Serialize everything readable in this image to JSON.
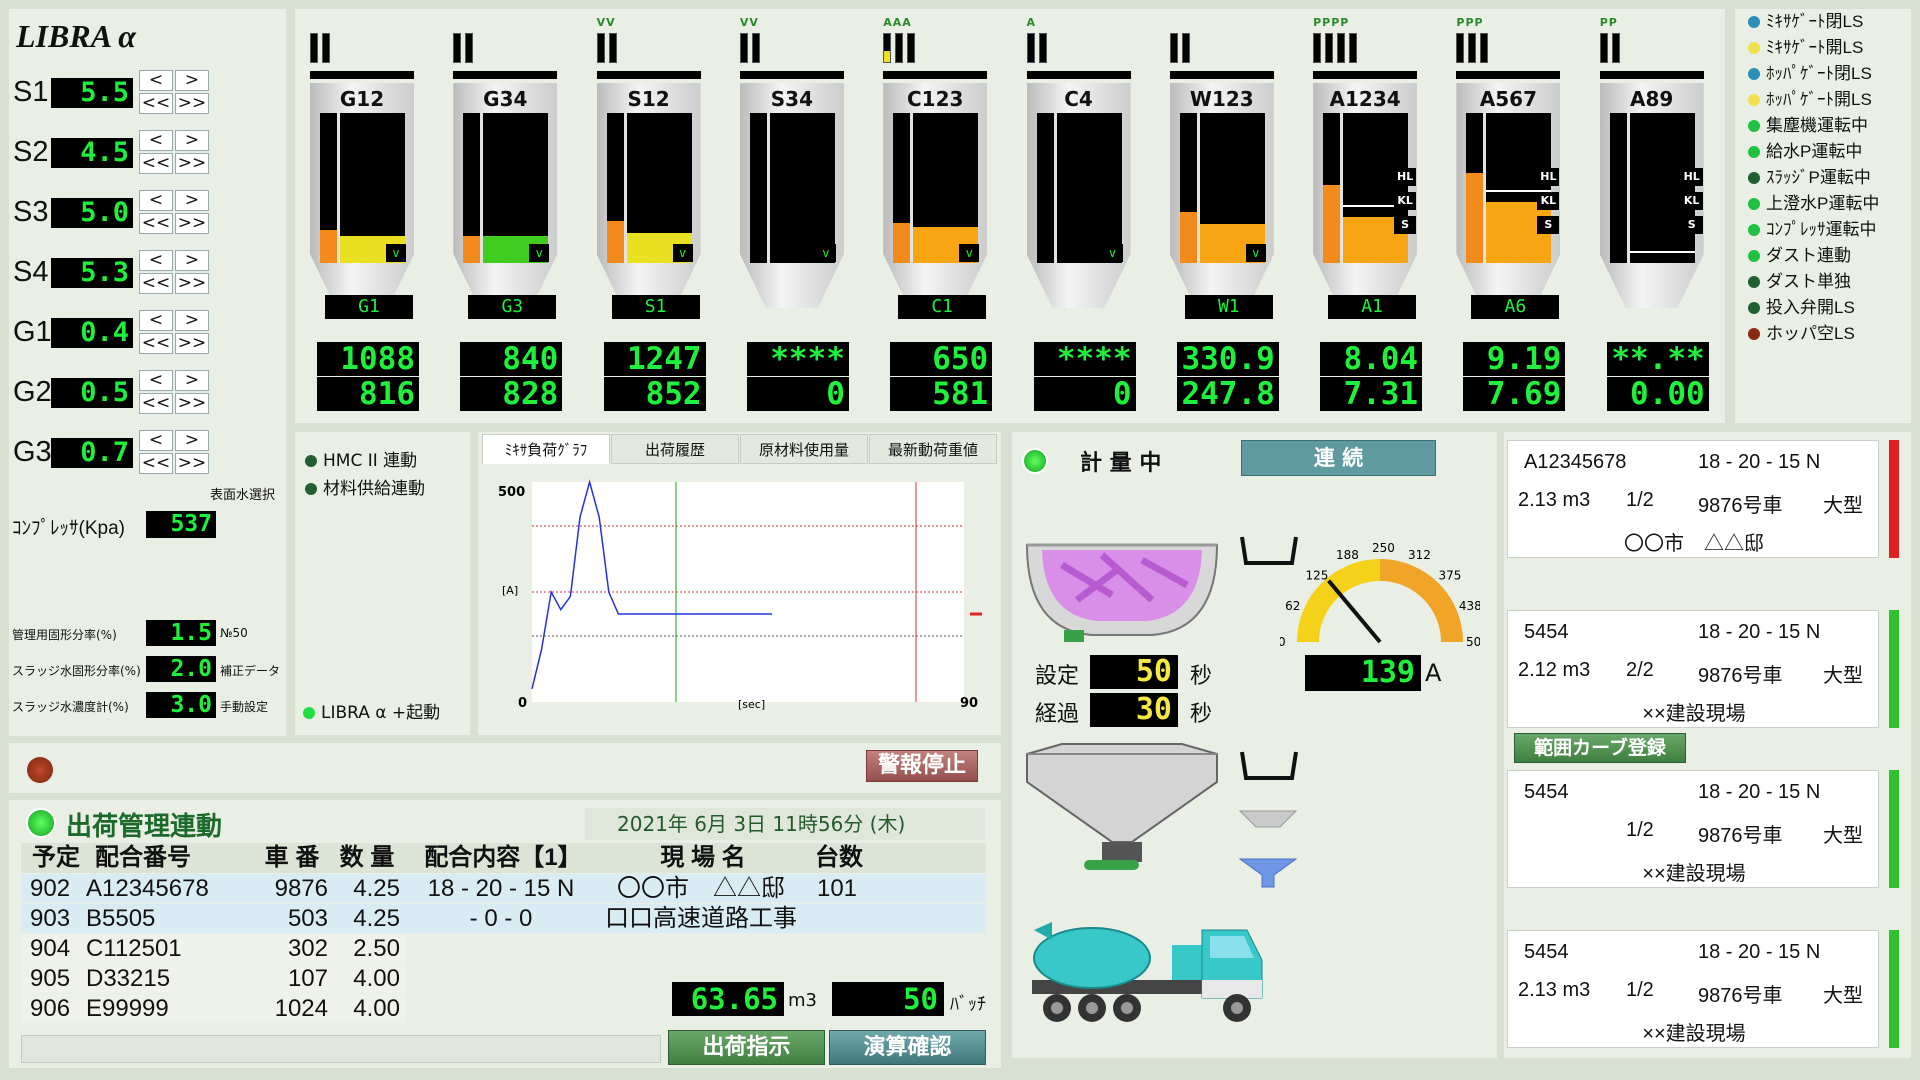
{
  "logo": "LIBRA α",
  "setpoints": [
    {
      "label": "S1",
      "value": "5.5"
    },
    {
      "label": "S2",
      "value": "4.5"
    },
    {
      "label": "S3",
      "value": "5.0"
    },
    {
      "label": "S4",
      "value": "5.3"
    },
    {
      "label": "G1",
      "value": "0.4"
    },
    {
      "label": "G2",
      "value": "0.5"
    },
    {
      "label": "G3",
      "value": "0.7"
    }
  ],
  "step_buttons": {
    "up": "<",
    "down": ">",
    "fast_up": "<<",
    "fast_down": ">>"
  },
  "surface_water_select": "表面水選択",
  "compressor": {
    "label": "ｺﾝﾌﾟﾚｯｻ(Kpa)",
    "value": "537"
  },
  "ratios": [
    {
      "label": "管理用固形分率(%)",
      "value": "1.5",
      "note": "№50"
    },
    {
      "label": "スラッジ水固形分率(%)",
      "value": "2.0",
      "note": "補正データ"
    },
    {
      "label": "スラッジ水濃度計(%)",
      "value": "3.0",
      "note": "手動設定"
    }
  ],
  "silos": [
    {
      "name": "G12",
      "mat": "G1",
      "top": "1088",
      "bottom": "816",
      "pips": "",
      "lvl": 0.22,
      "fill": 0.18,
      "color": "#e8e020",
      "tags": "v"
    },
    {
      "name": "G34",
      "mat": "G3",
      "top": "840",
      "bottom": "828",
      "pips": "",
      "lvl": 0.18,
      "fill": 0.18,
      "color": "#40cc20",
      "tags": "v"
    },
    {
      "name": "S12",
      "mat": "S1",
      "top": "1247",
      "bottom": "852",
      "pips": "VV",
      "lvl": 0.28,
      "fill": 0.2,
      "color": "#e8e020",
      "tags": "v"
    },
    {
      "name": "S34",
      "mat": "",
      "top": "****",
      "bottom": "0",
      "pips": "VV",
      "lvl": 0,
      "fill": 0,
      "color": "#e8e020",
      "tags": "v"
    },
    {
      "name": "C123",
      "mat": "C1",
      "top": "650",
      "bottom": "581",
      "pips": "AAA",
      "lvl": 0.27,
      "fill": 0.24,
      "color": "#f7a513",
      "tags": "v"
    },
    {
      "name": "C4",
      "mat": "",
      "top": "****",
      "bottom": "0",
      "pips": "A",
      "lvl": 0,
      "fill": 0,
      "color": "#f7a513",
      "tags": "v"
    },
    {
      "name": "W123",
      "mat": "W1",
      "top": "330.9",
      "bottom": "247.8",
      "pips": "",
      "lvl": 0.34,
      "fill": 0.26,
      "color": "#f7a513",
      "tags": "v"
    },
    {
      "name": "A1234",
      "mat": "A1",
      "top": "8.04",
      "bottom": "7.31",
      "pips": "PPPP",
      "lvl": 0.52,
      "fill": 0.31,
      "color": "#f7a513",
      "tags": "hks"
    },
    {
      "name": "A567",
      "mat": "A6",
      "top": "9.19",
      "bottom": "7.69",
      "pips": "PPP",
      "lvl": 0.6,
      "fill": 0.41,
      "color": "#f7a513",
      "tags": "hks"
    },
    {
      "name": "A89",
      "mat": "",
      "top": "**.**",
      "bottom": "0.00",
      "pips": "PP",
      "lvl": 0,
      "fill": 0,
      "color": "#f7a513",
      "tags": "hks"
    }
  ],
  "status": [
    {
      "label": "ﾐｷｻｹﾞｰﾄ閉LS",
      "color": "#2b8fb8"
    },
    {
      "label": "ﾐｷｻｹﾞｰﾄ開LS",
      "color": "#f0e050"
    },
    {
      "label": "ﾎｯﾊﾟｹﾞｰﾄ閉LS",
      "color": "#2b8fb8"
    },
    {
      "label": "ﾎｯﾊﾟｹﾞｰﾄ開LS",
      "color": "#f0e050"
    },
    {
      "label": "集塵機運転中",
      "color": "#20c040"
    },
    {
      "label": "給水P運転中",
      "color": "#20c040"
    },
    {
      "label": "ｽﾗｯｼﾞP運転中",
      "color": "#206030"
    },
    {
      "label": "上澄水P運転中",
      "color": "#20c040"
    },
    {
      "label": "ｺﾝﾌﾟﾚｯｻ運転中",
      "color": "#20c040"
    },
    {
      "label": "ダスト連動",
      "color": "#20c040"
    },
    {
      "label": "ダスト単独",
      "color": "#206030"
    },
    {
      "label": "投入弁開LS",
      "color": "#206030"
    },
    {
      "label": "ホッパ空LS",
      "color": "#8a2a10"
    }
  ],
  "links": {
    "hmc": "HMC II 連動",
    "material": "材料供給連動",
    "libra": "LIBRA α +起動"
  },
  "tabs": [
    "ﾐｷｻ負荷ｸﾞﾗﾌ",
    "出荷履歴",
    "原材料使用量",
    "最新動荷重値"
  ],
  "chart_data": {
    "type": "line",
    "ylabel": "[A]",
    "xlabel": "[sec]",
    "ymax_label": "500",
    "xmin_label": "0",
    "xmax_label": "90",
    "xlim": [
      0,
      90
    ],
    "ylim": [
      0,
      500
    ],
    "x": [
      0,
      2,
      4,
      6,
      8,
      10,
      12,
      14,
      16,
      18,
      20,
      25,
      30,
      40,
      50
    ],
    "y": [
      30,
      120,
      250,
      210,
      240,
      420,
      500,
      420,
      250,
      200,
      200,
      200,
      200,
      200,
      200
    ]
  },
  "mixing": {
    "state": "計 量 中",
    "mode": "連 続",
    "set_label": "設定",
    "set_value": "50",
    "elapsed_label": "経過",
    "elapsed_value": "30",
    "unit": "秒",
    "gauge_labels": [
      "0",
      "62",
      "125",
      "188",
      "250",
      "312",
      "375",
      "438",
      "500"
    ],
    "current": "139",
    "current_unit": "A",
    "gauge_value": 139,
    "gauge_max": 500
  },
  "alarm_stop": "警報停止",
  "shipping": {
    "title": "出荷管理連動",
    "date": "2021年 6月 3日 11時56分 (木)",
    "headers": [
      "予定",
      "配合番号",
      "車 番",
      "数 量",
      "配合内容【1】",
      "現 場 名",
      "台数"
    ],
    "rows": [
      [
        "902",
        "A12345678",
        "9876",
        "4.25",
        "18 - 20 - 15 N",
        "〇〇市　△△邸",
        "101"
      ],
      [
        "903",
        "B5505",
        "503",
        "4.25",
        "- 0 - 0",
        "口口高速道路工事",
        ""
      ],
      [
        "904",
        "C112501",
        "302",
        "2.50",
        "",
        "",
        ""
      ],
      [
        "905",
        "D33215",
        "107",
        "4.00",
        "",
        "",
        ""
      ],
      [
        "906",
        "E99999",
        "1024",
        "4.00",
        "",
        "",
        ""
      ]
    ],
    "volume": "63.65",
    "volume_unit": "m3",
    "batch": "50",
    "batch_unit": "ﾊﾞｯﾁ",
    "btn_ship": "出荷指示",
    "btn_calc": "演算確認"
  },
  "range_curve": "範囲カーブ登録",
  "cards": [
    {
      "id": "A12345678",
      "mix": "18 - 20 - 15 N",
      "vol": "2.13 m3",
      "frac": "1/2",
      "truck": "9876号車",
      "size": "大型",
      "site": "〇〇市　△△邸",
      "bar": "#e02020"
    },
    {
      "id": "5454",
      "mix": "18 - 20 - 15 N",
      "vol": "2.12 m3",
      "frac": "2/2",
      "truck": "9876号車",
      "size": "大型",
      "site": "××建設現場",
      "bar": "#30c030"
    },
    {
      "id": "5454",
      "mix": "18 - 20 - 15 N",
      "vol": "",
      "frac": "1/2",
      "truck": "9876号車",
      "size": "大型",
      "site": "××建設現場",
      "bar": "#30c030"
    },
    {
      "id": "5454",
      "mix": "18 - 20 - 15 N",
      "vol": "2.13 m3",
      "frac": "1/2",
      "truck": "9876号車",
      "size": "大型",
      "site": "××建設現場",
      "bar": "#30c030"
    }
  ]
}
